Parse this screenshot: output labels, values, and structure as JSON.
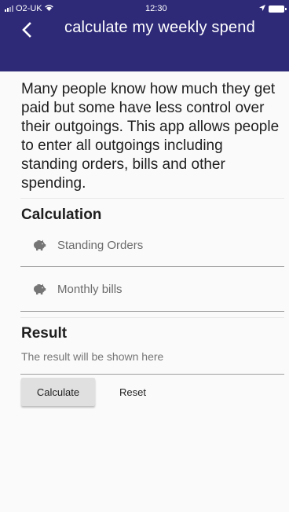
{
  "status_bar": {
    "carrier": "O2-UK",
    "time": "12:30"
  },
  "app_bar": {
    "title": "calculate my weekly spend",
    "background_color": "#2e2a78"
  },
  "intro": {
    "text": "Many people know how much they get paid but some have less control over their outgoings. This app allows people to enter all outgoings including standing orders, bills and other spending."
  },
  "calculation": {
    "heading": "Calculation",
    "items": [
      {
        "label": "Standing Orders",
        "icon": "piggy-bank-icon"
      },
      {
        "label": "Monthly bills",
        "icon": "piggy-bank-icon"
      }
    ]
  },
  "result": {
    "heading": "Result",
    "text": "The result will be shown here"
  },
  "actions": {
    "calculate_label": "Calculate",
    "reset_label": "Reset"
  }
}
